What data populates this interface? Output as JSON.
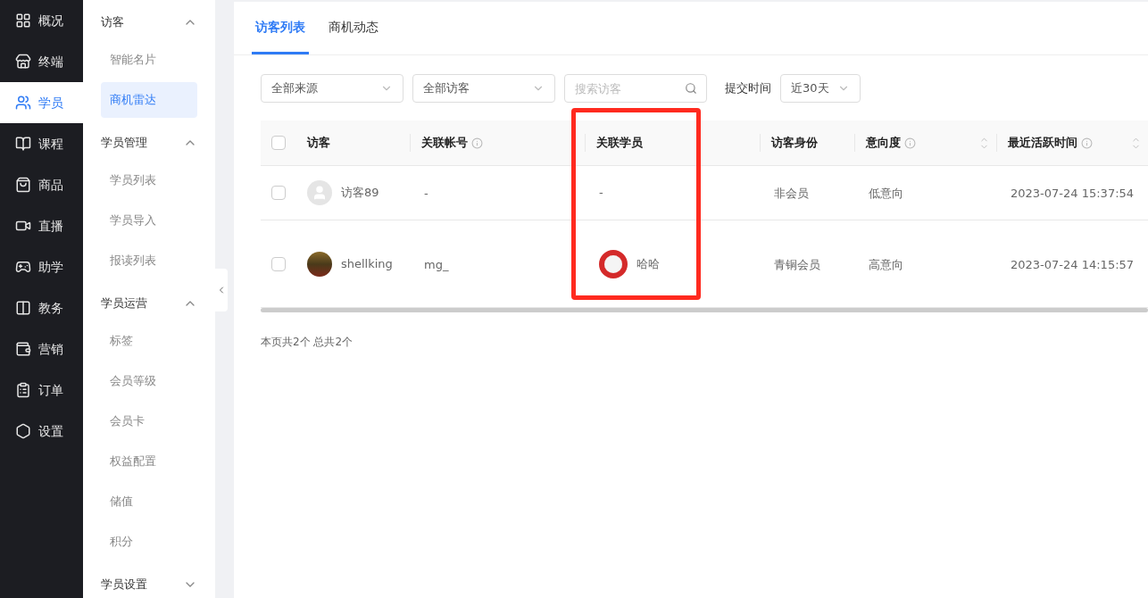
{
  "nav": [
    {
      "label": "概况",
      "selected": false
    },
    {
      "label": "终端",
      "selected": false
    },
    {
      "label": "学员",
      "selected": true
    },
    {
      "label": "课程",
      "selected": false
    },
    {
      "label": "商品",
      "selected": false
    },
    {
      "label": "直播",
      "selected": false
    },
    {
      "label": "助学",
      "selected": false
    },
    {
      "label": "教务",
      "selected": false
    },
    {
      "label": "营销",
      "selected": false
    },
    {
      "label": "订单",
      "selected": false
    },
    {
      "label": "设置",
      "selected": false
    }
  ],
  "submenu": [
    {
      "title": "访客",
      "expanded": true,
      "items": [
        {
          "label": "智能名片",
          "selected": false
        },
        {
          "label": "商机雷达",
          "selected": true
        }
      ]
    },
    {
      "title": "学员管理",
      "expanded": true,
      "items": [
        {
          "label": "学员列表",
          "selected": false
        },
        {
          "label": "学员导入",
          "selected": false
        },
        {
          "label": "报读列表",
          "selected": false
        }
      ]
    },
    {
      "title": "学员运营",
      "expanded": true,
      "items": [
        {
          "label": "标签",
          "selected": false
        },
        {
          "label": "会员等级",
          "selected": false
        },
        {
          "label": "会员卡",
          "selected": false
        },
        {
          "label": "权益配置",
          "selected": false
        },
        {
          "label": "储值",
          "selected": false
        },
        {
          "label": "积分",
          "selected": false
        }
      ]
    },
    {
      "title": "学员设置",
      "expanded": false
    }
  ],
  "tabs": [
    {
      "label": "访客列表",
      "selected": true
    },
    {
      "label": "商机动态",
      "selected": false
    }
  ],
  "filters": {
    "source": "全部来源",
    "visitor": "全部访客",
    "search_placeholder": "搜索访客",
    "time_label": "提交时间",
    "time": "近30天"
  },
  "table": {
    "select_all_checked": false,
    "columns": [
      {
        "label": "访客",
        "info": false,
        "sortable": false
      },
      {
        "label": "关联帐号",
        "info": true,
        "sortable": false
      },
      {
        "label": "关联学员",
        "info": false,
        "sortable": false
      },
      {
        "label": "访客身份",
        "info": false,
        "sortable": false
      },
      {
        "label": "意向度",
        "info": true,
        "sortable": true
      },
      {
        "label": "最近活跃时间",
        "info": true,
        "sortable": true
      }
    ],
    "rows": [
      {
        "checked": false,
        "avatar_photo": false,
        "visitor": "访客89",
        "account": "-",
        "student": "-",
        "student_avatar": false,
        "identity": "非会员",
        "intent": "低意向",
        "active_time": "2023-07-24 15:37:54"
      },
      {
        "checked": false,
        "avatar_photo": true,
        "visitor": "shellking",
        "account": "mg_",
        "student": "哈哈",
        "student_avatar": true,
        "identity": "青铜会员",
        "intent": "高意向",
        "active_time": "2023-07-24 14:15:57"
      }
    ]
  },
  "summary": "本页共2个 总共2个"
}
